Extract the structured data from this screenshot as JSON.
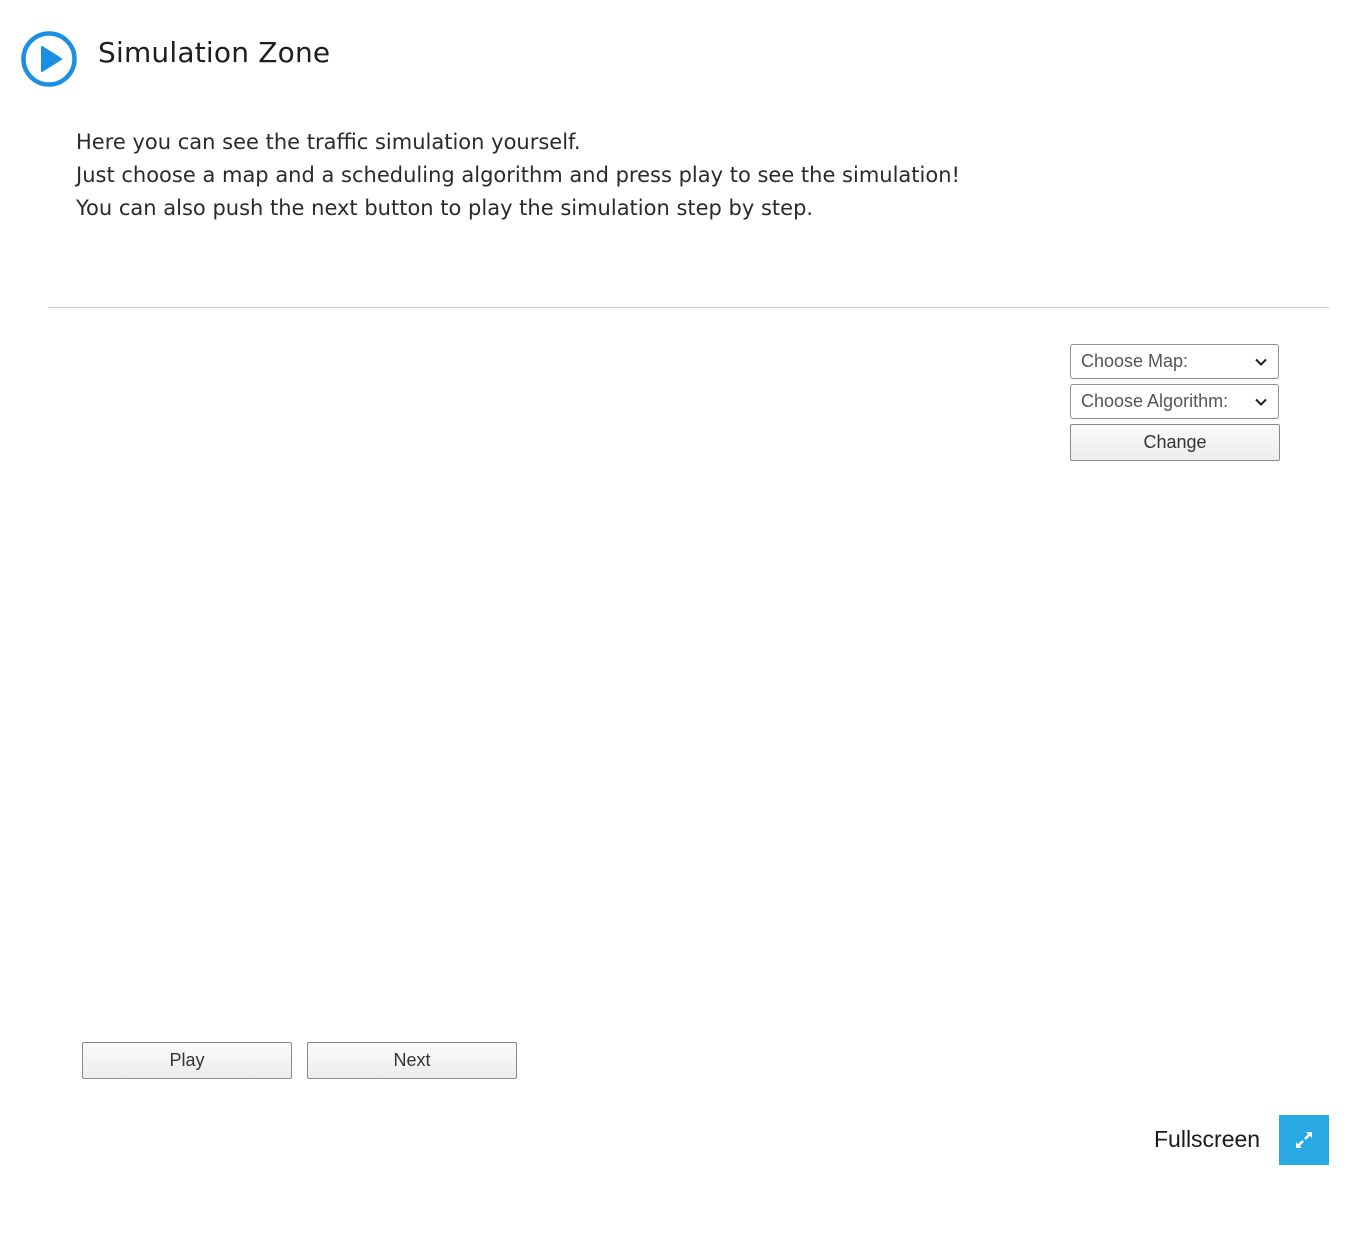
{
  "header": {
    "title": "Simulation Zone",
    "icon": "play-circle-icon",
    "icon_color": "#1a8fe3"
  },
  "intro": {
    "lines": [
      "Here you can see the traffic simulation yourself.",
      "Just choose a map and a scheduling algorithm and press play to see the simulation!",
      "You can also push the next button to play the simulation step by step."
    ]
  },
  "controls": {
    "map_select": "Choose Map:",
    "algorithm_select": "Choose Algorithm:",
    "change_label": "Change",
    "play_label": "Play",
    "next_label": "Next"
  },
  "footer": {
    "fullscreen_label": "Fullscreen",
    "fullscreen_icon": "expand-icon",
    "fullscreen_color": "#29a9e1"
  }
}
